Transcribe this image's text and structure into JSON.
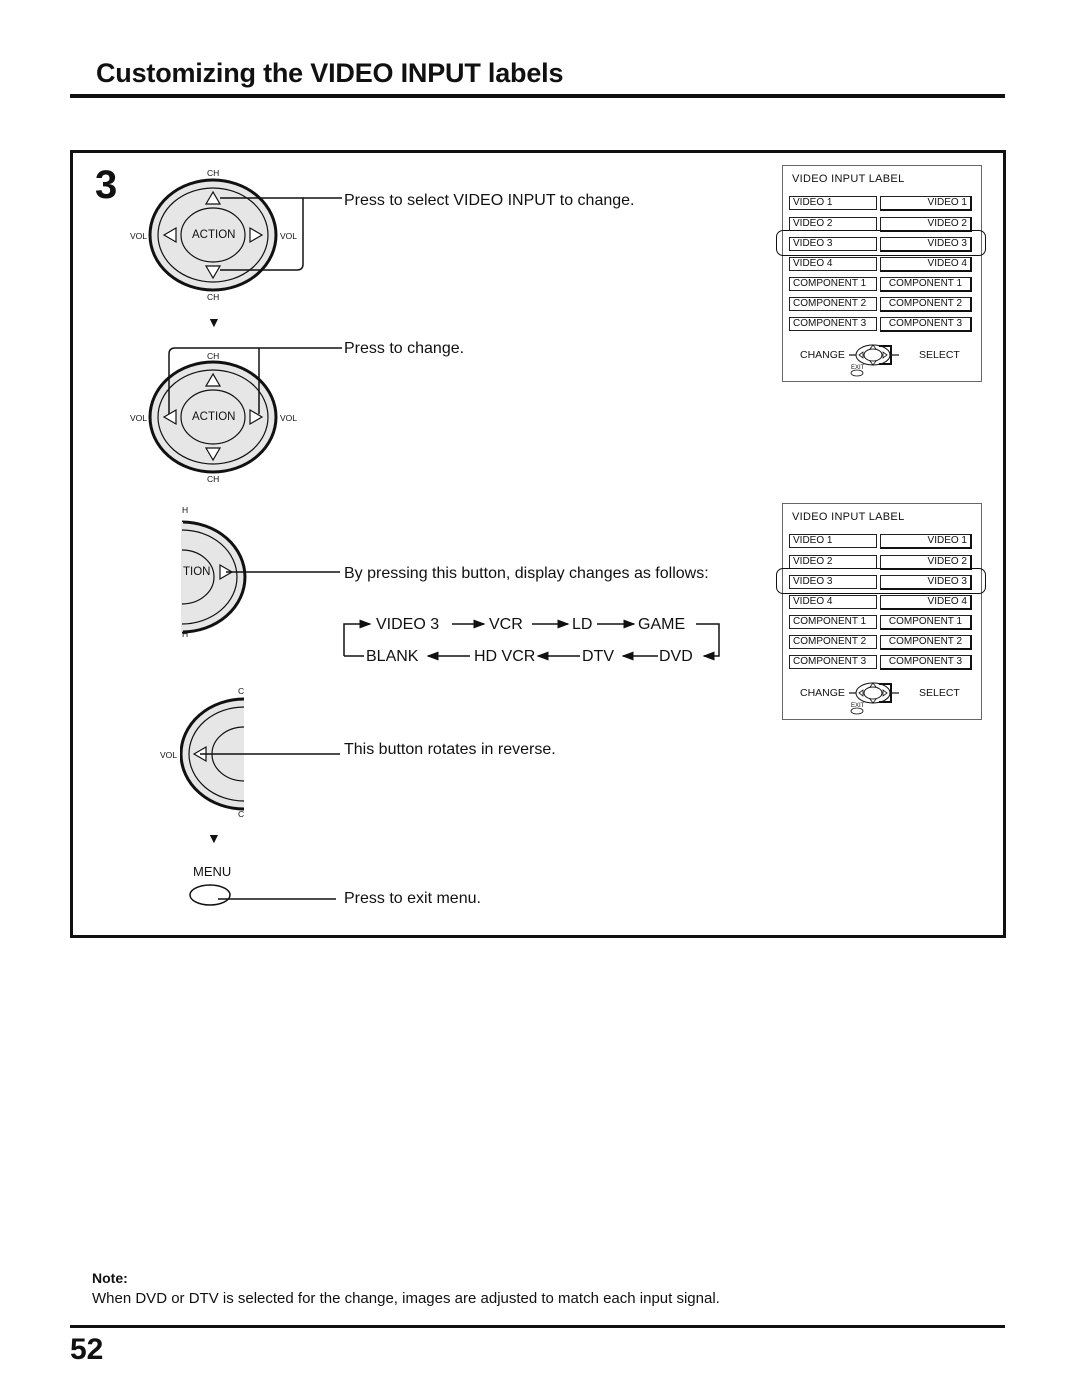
{
  "page": {
    "title": "Customizing the VIDEO INPUT labels",
    "page_number": "52"
  },
  "step": {
    "number": "3",
    "instructions": {
      "select": "Press to select VIDEO INPUT to change.",
      "change": "Press to change.",
      "cycle_intro": "By pressing this button, display changes as follows:",
      "reverse": "This button rotates in reverse.",
      "exit": "Press to exit menu."
    },
    "cycle": {
      "top_row": [
        "VIDEO 3",
        "VCR",
        "LD",
        "GAME"
      ],
      "bottom_row": [
        "BLANK",
        "HD VCR",
        "DTV",
        "DVD"
      ]
    }
  },
  "remote": {
    "center_label": "ACTION",
    "ch_label": "CH",
    "vol_label": "VOL",
    "partial_center_label": "TION",
    "partial_ch_top": "H",
    "partial_ch_left": "C",
    "menu_label": "MENU"
  },
  "osd_panels": [
    {
      "title": "VIDEO  INPUT  LABEL",
      "rows": [
        {
          "input": "VIDEO 1",
          "label": "VIDEO 1"
        },
        {
          "input": "VIDEO 2",
          "label": "VIDEO 2"
        },
        {
          "input": "VIDEO 3",
          "label": "VIDEO 3",
          "highlighted": true
        },
        {
          "input": "VIDEO 4",
          "label": "VIDEO 4"
        },
        {
          "input": "COMPONENT 1",
          "label": "COMPONENT 1"
        },
        {
          "input": "COMPONENT 2",
          "label": "COMPONENT 2"
        },
        {
          "input": "COMPONENT 3",
          "label": "COMPONENT 3"
        }
      ],
      "change_label": "CHANGE",
      "select_label": "SELECT",
      "exit_label": "EXIT"
    },
    {
      "title": "VIDEO  INPUT  LABEL",
      "rows": [
        {
          "input": "VIDEO 1",
          "label": "VIDEO 1"
        },
        {
          "input": "VIDEO 2",
          "label": "VIDEO 2"
        },
        {
          "input": "VIDEO 3",
          "label": "VIDEO 3",
          "highlighted": true
        },
        {
          "input": "VIDEO 4",
          "label": "VIDEO 4"
        },
        {
          "input": "COMPONENT 1",
          "label": "COMPONENT 1"
        },
        {
          "input": "COMPONENT 2",
          "label": "COMPONENT 2"
        },
        {
          "input": "COMPONENT 3",
          "label": "COMPONENT 3"
        }
      ],
      "change_label": "CHANGE",
      "select_label": "SELECT",
      "exit_label": "EXIT"
    }
  ],
  "note": {
    "label": "Note:",
    "text": "When DVD or DTV is selected for the change, images are adjusted to match each input signal."
  }
}
